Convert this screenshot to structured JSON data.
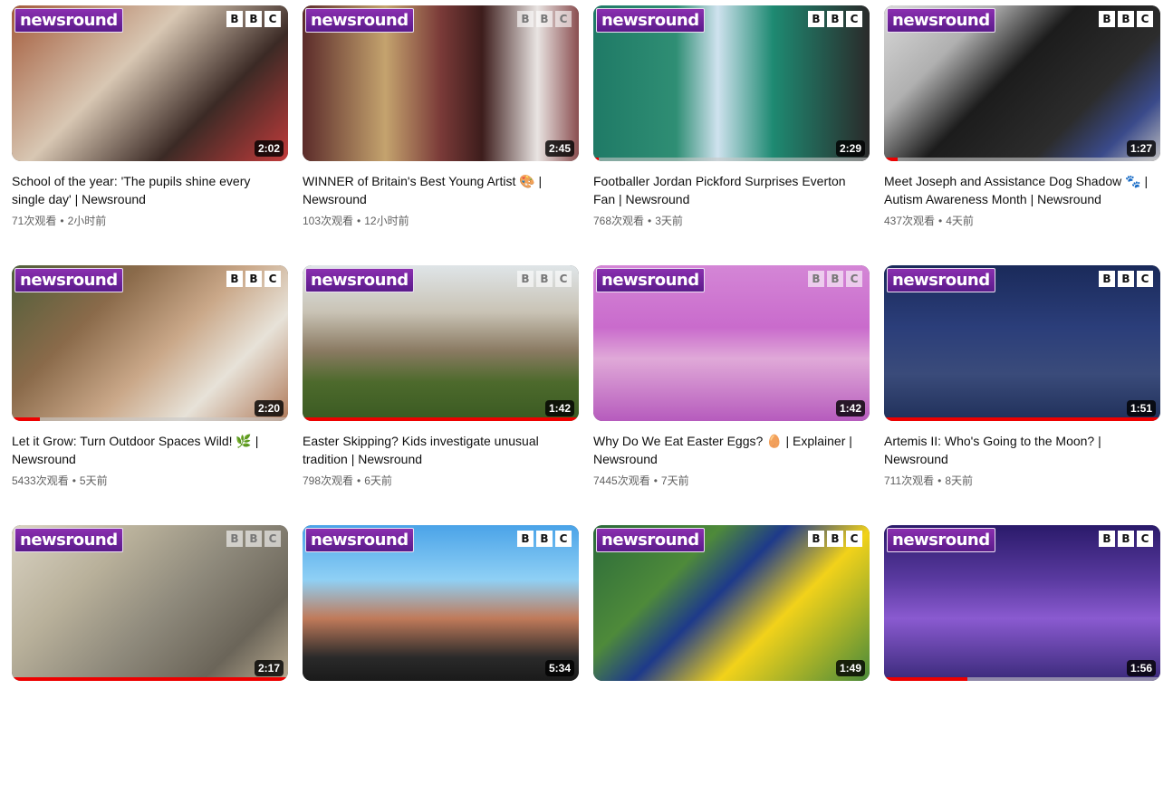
{
  "videos": [
    {
      "title": "School of the year: 'The pupils shine every single day' | Newsround",
      "views": "71次观看",
      "age": "2小时前",
      "duration": "2:02",
      "progress": 0,
      "bbc_faded": false,
      "bg": "linear-gradient(135deg,#a35a3a 0%,#d8c7b3 40%,#3b2a25 70%,#c23b3b 100%)"
    },
    {
      "title": "WINNER of Britain's Best Young Artist 🎨 | Newsround",
      "views": "103次观看",
      "age": "12小时前",
      "duration": "2:45",
      "progress": 0,
      "bbc_faded": true,
      "bg": "linear-gradient(90deg,#5b2b2a 0%,#c4a36e 30%,#7a3a38 50%,#3d1d1c 65%,#e9e4e2 85%,#8a4e50 100%)"
    },
    {
      "title": "Footballer Jordan Pickford Surprises Everton Fan | Newsround",
      "views": "768次观看",
      "age": "3天前",
      "duration": "2:29",
      "progress": 0.02,
      "bbc_faded": false,
      "bg": "linear-gradient(90deg,#1f7a66 0%,#2f8e74 30%,#cfe2ee 45%,#1e8a72 65%,#2a2a2a 100%)"
    },
    {
      "title": "Meet Joseph and Assistance Dog Shadow 🐾 | Autism Awareness Month | Newsround",
      "views": "437次观看",
      "age": "4天前",
      "duration": "1:27",
      "progress": 0.05,
      "bbc_faded": false,
      "bg": "linear-gradient(135deg,#d9d9d9 0%,#b0b0b0 25%,#1c1c1c 45%,#2c2c2c 70%,#3a4a8a 85%,#c0c0c0 100%)"
    },
    {
      "title": "Let it Grow: Turn Outdoor Spaces Wild! 🌿 | Newsround",
      "views": "5433次观看",
      "age": "5天前",
      "duration": "2:20",
      "progress": 0.1,
      "bbc_faded": false,
      "bg": "linear-gradient(135deg,#4f5f3a 0%,#8a6a4a 30%,#caa889 55%,#e7e2d8 75%,#b07a5a 100%)"
    },
    {
      "title": "Easter Skipping? Kids investigate unusual tradition | Newsround",
      "views": "798次观看",
      "age": "6天前",
      "duration": "1:42",
      "progress": 1,
      "bbc_faded": true,
      "bg": "linear-gradient(180deg,#dfe5e8 0%,#c9c3b5 30%,#8a7a62 55%,#4d6a2c 75%,#3a5a22 100%)"
    },
    {
      "title": "Why Do We Eat Easter Eggs? 🥚 | Explainer | Newsround",
      "views": "7445次观看",
      "age": "7天前",
      "duration": "1:42",
      "progress": 0,
      "bbc_faded": true,
      "bg": "linear-gradient(180deg,#d486d6 0%,#c96bcc 40%,#e0a9d8 60%,#b65bbd 100%)"
    },
    {
      "title": "Artemis II: Who's Going to the Moon? | Newsround",
      "views": "711次观看",
      "age": "8天前",
      "duration": "1:51",
      "progress": 1,
      "bbc_faded": false,
      "bg": "linear-gradient(180deg,#1a2a5a 0%,#2b3e7a 40%,#3a4b7a 70%,#20305a 100%)"
    },
    {
      "title": "",
      "views": "",
      "age": "",
      "duration": "2:17",
      "progress": 1,
      "bbc_faded": true,
      "bg": "linear-gradient(135deg,#d9d2c2 0%,#b8b09a 30%,#8f8a7c 55%,#6b6559 80%,#b7a98f 100%)"
    },
    {
      "title": "",
      "views": "",
      "age": "",
      "duration": "5:34",
      "progress": 0,
      "bbc_faded": false,
      "bg": "linear-gradient(180deg,#4aa3e8 0%,#8fd0f5 35%,#c07a5a 60%,#2a2a2a 85%,#1a1a1a 100%)"
    },
    {
      "title": "",
      "views": "",
      "age": "",
      "duration": "1:49",
      "progress": 0,
      "bbc_faded": false,
      "bg": "linear-gradient(135deg,#2a6a3a 0%,#4e8a3a 30%,#1e3a8a 45%,#f2d21a 65%,#4a8a3a 100%)"
    },
    {
      "title": "",
      "views": "",
      "age": "",
      "duration": "1:56",
      "progress": 0.3,
      "bbc_faded": false,
      "bg": "linear-gradient(180deg,#2a1a6a 0%,#5a3aa0 35%,#8a5ad0 60%,#3a2a7a 100%)"
    }
  ],
  "logo_text": "newsround",
  "bbc_letters": [
    "B",
    "B",
    "C"
  ],
  "meta_separator": "•",
  "colors": {
    "progress_red": "#e00000",
    "logo_purple": "#7a2aa0"
  }
}
